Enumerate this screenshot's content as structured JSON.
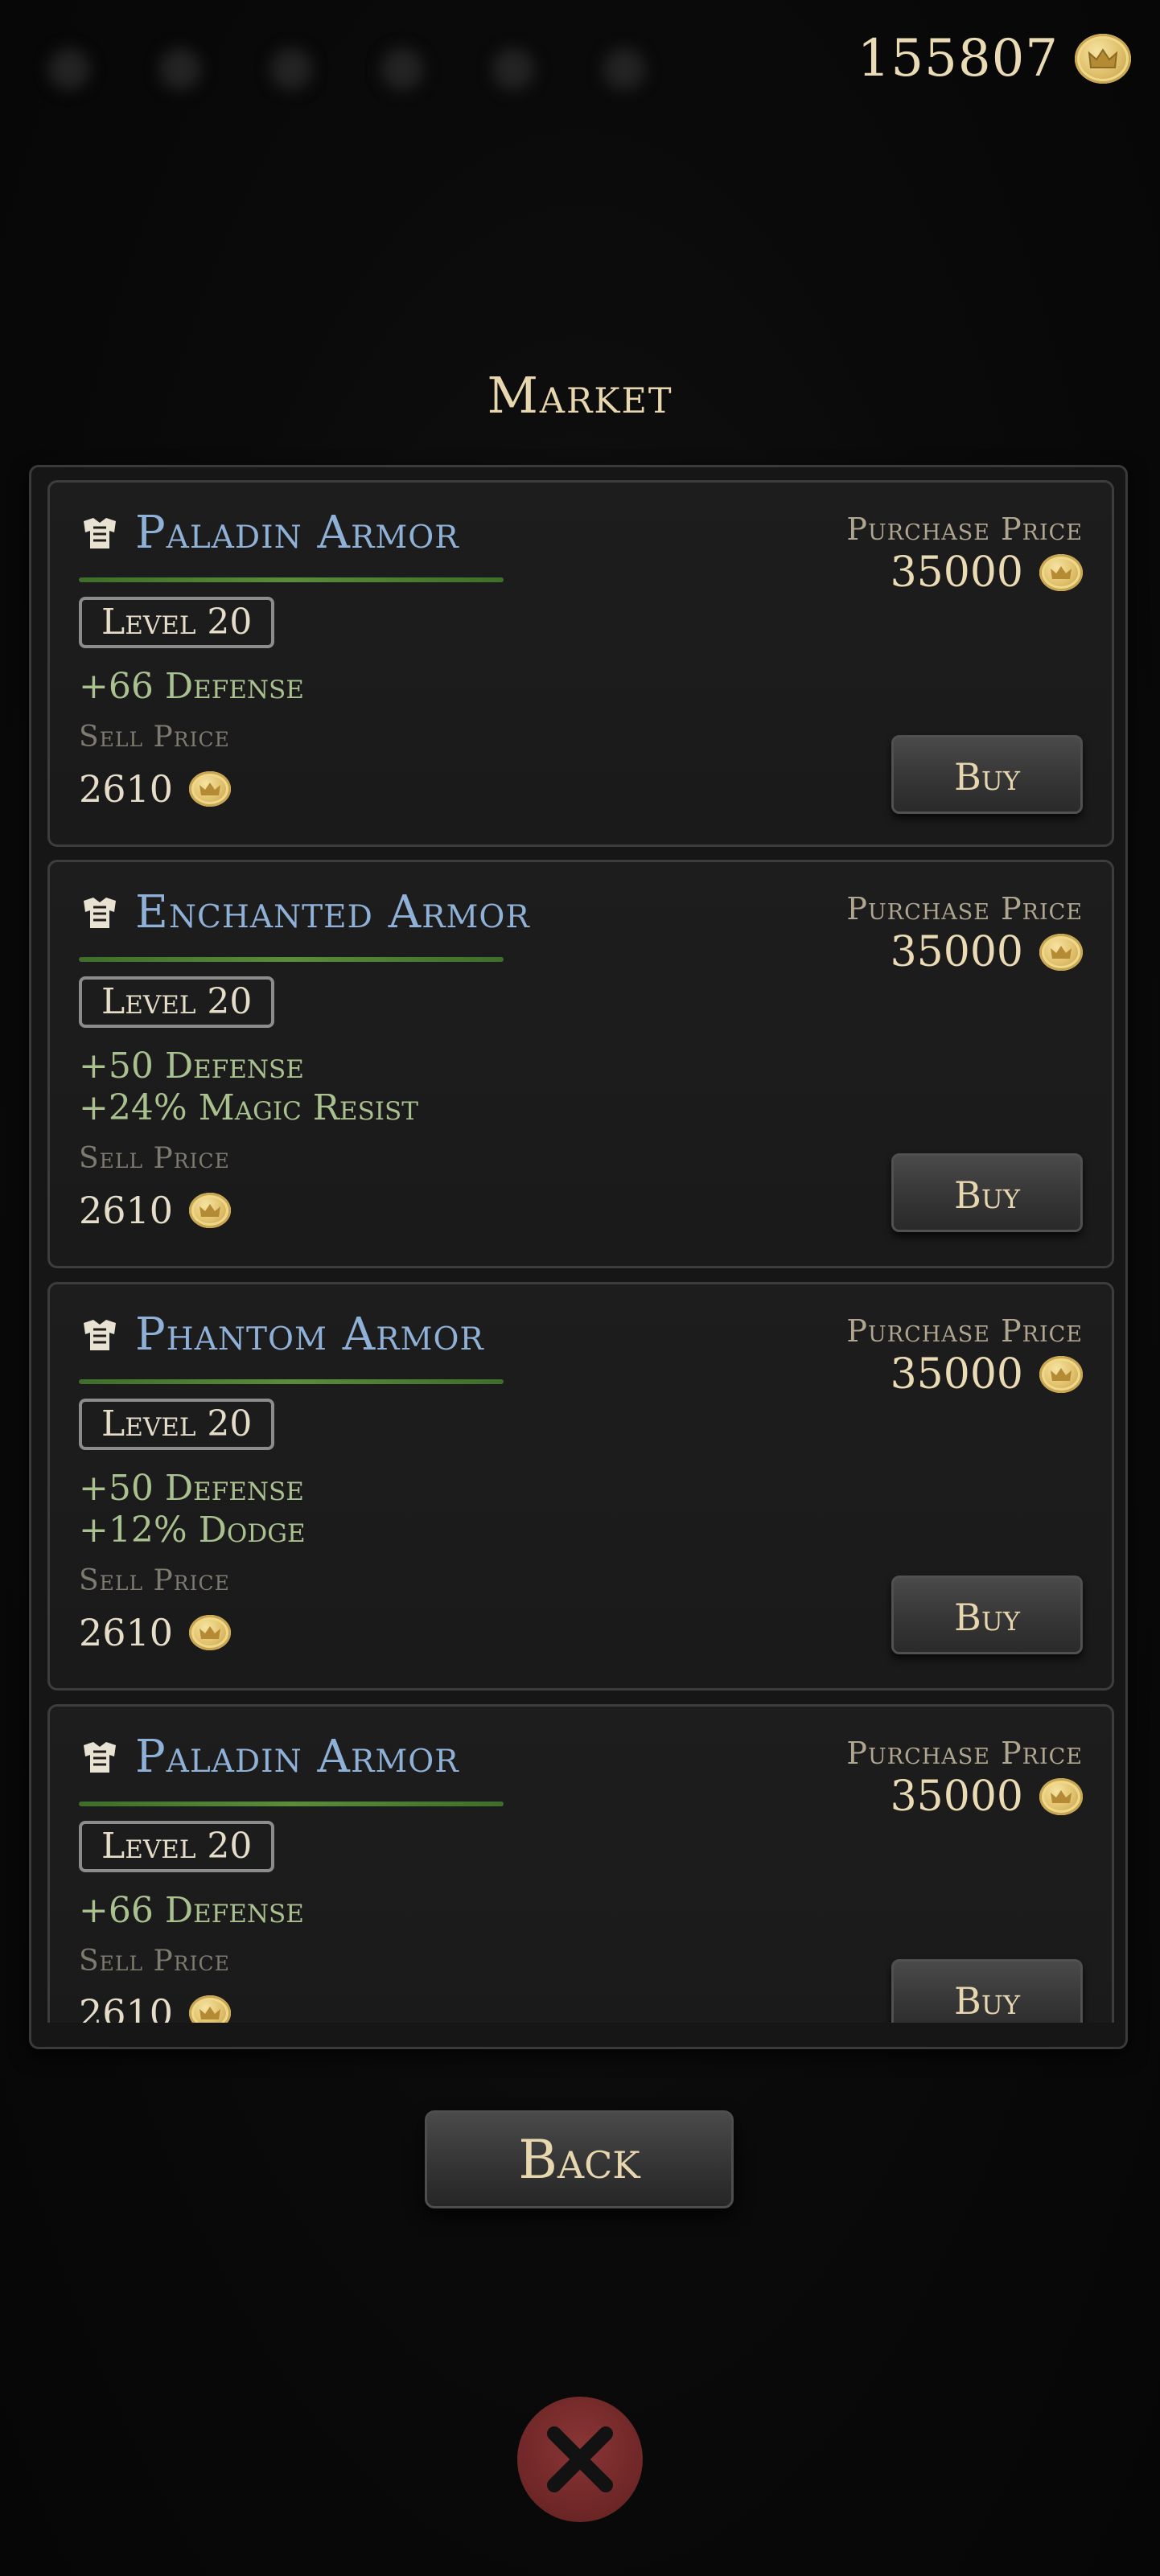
{
  "header": {
    "gold": "155807",
    "currency_icon": "crown-coin-icon"
  },
  "market": {
    "title": "Market",
    "items": [
      {
        "icon": "armor-icon",
        "name": "Paladin Armor",
        "level": "Level 20",
        "stats": [
          "+66 Defense"
        ],
        "sell_label": "Sell Price",
        "sell_price": "2610",
        "purchase_label": "Purchase Price",
        "purchase_price": "35000",
        "buy_label": "Buy"
      },
      {
        "icon": "armor-icon",
        "name": "Enchanted Armor",
        "level": "Level 20",
        "stats": [
          "+50 Defense",
          "+24% Magic Resist"
        ],
        "sell_label": "Sell Price",
        "sell_price": "2610",
        "purchase_label": "Purchase Price",
        "purchase_price": "35000",
        "buy_label": "Buy"
      },
      {
        "icon": "armor-icon",
        "name": "Phantom Armor",
        "level": "Level 20",
        "stats": [
          "+50 Defense",
          "+12% Dodge"
        ],
        "sell_label": "Sell Price",
        "sell_price": "2610",
        "purchase_label": "Purchase Price",
        "purchase_price": "35000",
        "buy_label": "Buy"
      },
      {
        "icon": "armor-icon",
        "name": "Paladin Armor",
        "level": "Level 20",
        "stats": [
          "+66 Defense"
        ],
        "sell_label": "Sell Price",
        "sell_price": "2610",
        "purchase_label": "Purchase Price",
        "purchase_price": "35000",
        "buy_label": "Buy"
      }
    ]
  },
  "footer": {
    "back_label": "Back",
    "close_icon": "close-x-icon"
  },
  "colors": {
    "item_name": "#8fb1d7",
    "stat_text": "#a9c08f",
    "gold_text": "#eadbb4",
    "close_button": "#6d2626"
  }
}
